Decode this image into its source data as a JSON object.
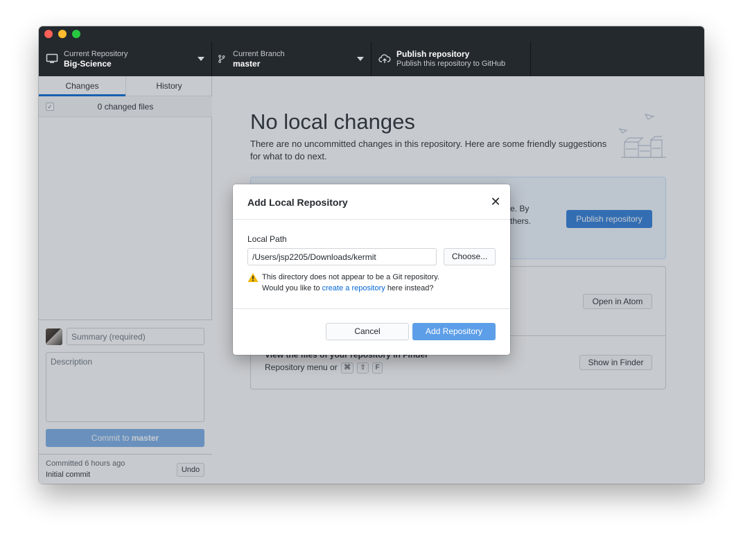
{
  "toolbar": {
    "repo_label": "Current Repository",
    "repo_name": "Big-Science",
    "branch_label": "Current Branch",
    "branch_name": "master",
    "publish_title": "Publish repository",
    "publish_subtitle": "Publish this repository to GitHub",
    "icons": [
      "monitor-icon",
      "git-branch-icon",
      "cloud-upload-icon"
    ]
  },
  "sidebar": {
    "tabs": [
      {
        "label": "Changes",
        "selected": true
      },
      {
        "label": "History",
        "selected": false
      }
    ],
    "changed_files": "0 changed files",
    "summary_placeholder": "Summary (required)",
    "description_placeholder": "Description",
    "commit_prefix": "Commit to",
    "commit_branch": "master",
    "last_commit_time": "Committed 6 hours ago",
    "last_commit_message": "Initial commit",
    "undo_label": "Undo"
  },
  "main": {
    "heading": "No local changes",
    "intro": "There are no uncommitted changes in this repository. Here are some friendly suggestions for what to do next.",
    "publish_partial_line1": "e. By",
    "publish_partial_line2": "thers.",
    "publish_button": "Publish repository",
    "open_editor_button": "Open in Atom",
    "finder_title": "View the files of your repository in Finder",
    "finder_sub_prefix": "Repository menu or",
    "finder_keys": [
      "⌘",
      "⇧",
      "F"
    ],
    "show_in_finder_button": "Show in Finder"
  },
  "dialog": {
    "title": "Add Local Repository",
    "path_label": "Local Path",
    "path_value": "/Users/jsp2205/Downloads/kermit",
    "choose_button": "Choose...",
    "warning_line1": "This directory does not appear to be a Git repository.",
    "warning_prefix": "Would you like to",
    "warning_link": "create a repository",
    "warning_suffix": "here instead?",
    "cancel_button": "Cancel",
    "add_button": "Add Repository"
  },
  "colors": {
    "toolbar_bg": "#24292e",
    "accent": "#0366d6",
    "primary_button": "#5d9ee8",
    "warning": "#f2b705"
  }
}
